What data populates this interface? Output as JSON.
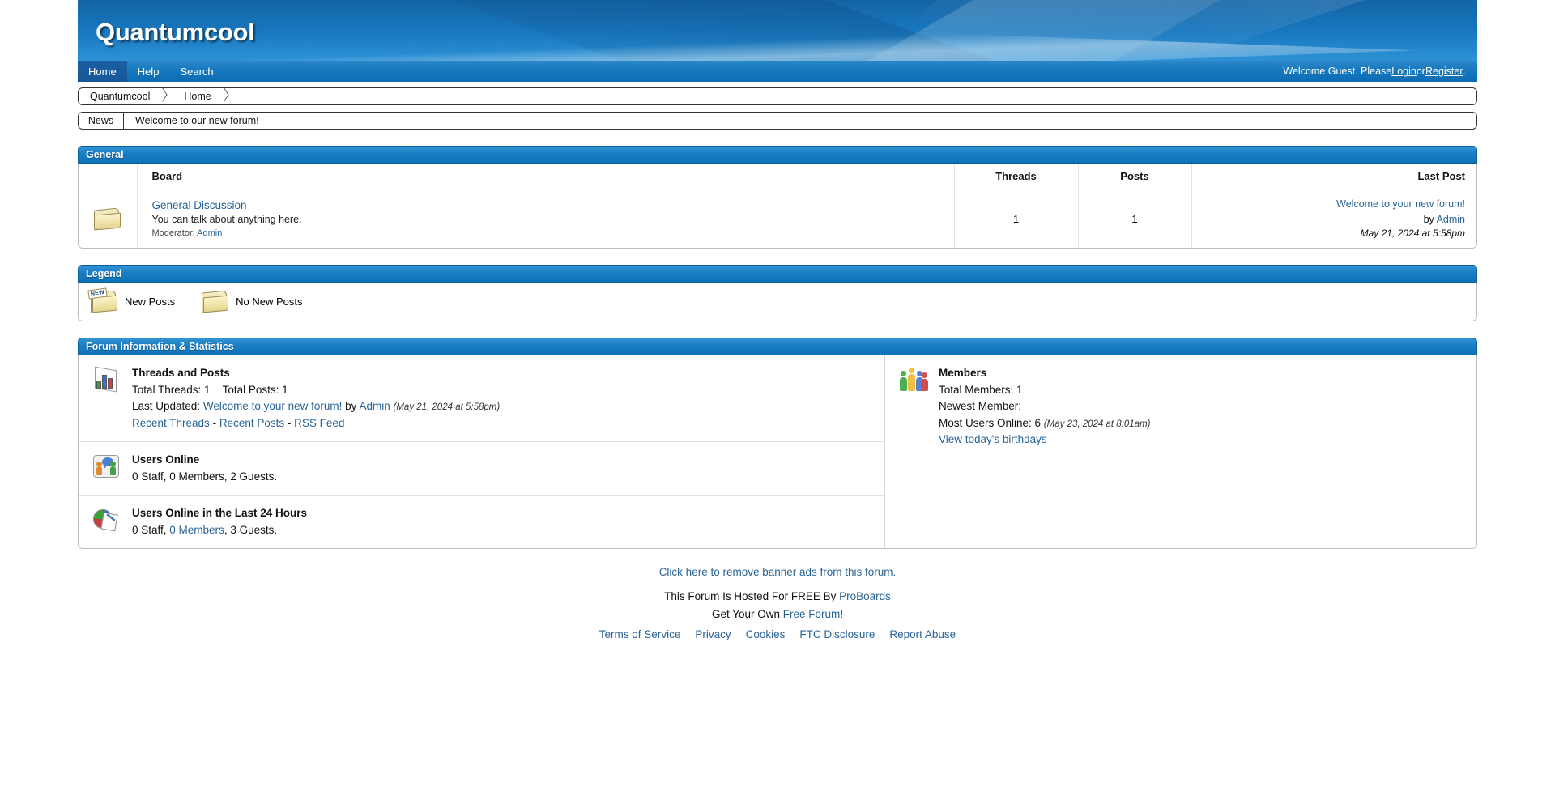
{
  "site": {
    "title": "Quantumcool"
  },
  "nav": {
    "items": [
      {
        "label": "Home",
        "active": true
      },
      {
        "label": "Help",
        "active": false
      },
      {
        "label": "Search",
        "active": false
      }
    ],
    "welcome_prefix": "Welcome Guest. Please ",
    "login_label": "Login",
    "welcome_or": " or ",
    "register_label": "Register",
    "welcome_suffix": "."
  },
  "breadcrumb": {
    "items": [
      "Quantumcool",
      "Home"
    ]
  },
  "news": {
    "label": "News",
    "text": "Welcome to our new forum!"
  },
  "general_section": {
    "heading": "General",
    "columns": {
      "board": "Board",
      "threads": "Threads",
      "posts": "Posts",
      "last_post": "Last Post"
    },
    "rows": [
      {
        "icon": "folder-no-new-posts-icon",
        "title": "General Discussion",
        "description": "You can talk about anything here.",
        "moderator_label": "Moderator:",
        "moderator": "Admin",
        "threads": "1",
        "posts": "1",
        "last_post_title": "Welcome to your new forum!",
        "last_post_by_label": "by",
        "last_post_author": "Admin",
        "last_post_date": "May 21, 2024 at 5:58pm"
      }
    ]
  },
  "legend_section": {
    "heading": "Legend",
    "items": [
      {
        "icon": "folder-new-posts-icon",
        "label": "New Posts"
      },
      {
        "icon": "folder-no-new-posts-icon",
        "label": "No New Posts"
      }
    ]
  },
  "stats_section": {
    "heading": "Forum Information & Statistics",
    "threads_and_posts": {
      "icon": "bar-chart-icon",
      "title": "Threads and Posts",
      "total_threads": "Total Threads: 1",
      "total_posts": "Total Posts: 1",
      "last_updated_label": "Last Updated:",
      "last_updated_thread": "Welcome to your new forum!",
      "last_updated_by": "by",
      "last_updated_author": "Admin",
      "last_updated_date": "(May 21, 2024 at 5:58pm)",
      "links": [
        "Recent Threads",
        "Recent Posts",
        "RSS Feed"
      ],
      "link_sep": "-"
    },
    "members": {
      "icon": "people-group-icon",
      "title": "Members",
      "total_members": "Total Members: 1",
      "newest_member": "Newest Member:",
      "most_users_online": "Most Users Online: 6",
      "most_users_online_date": "(May 23, 2024 at 8:01am)",
      "birthdays_link": "View today's birthdays"
    },
    "users_online": {
      "icon": "users-online-icon",
      "title": "Users Online",
      "text_a": "0 Staff, 0 Members, 2 Guests."
    },
    "users_online_24h": {
      "icon": "pie-chart-icon",
      "title": "Users Online in the Last 24 Hours",
      "prefix": "0 Staff, ",
      "members_link": "0 Members",
      "suffix": ", 3 Guests."
    }
  },
  "footer": {
    "remove_ads": "Click here to remove banner ads from this forum.",
    "hosted_prefix": "This Forum Is Hosted For FREE By ",
    "hosted_link": "ProBoards",
    "get_own_prefix": "Get Your Own ",
    "get_own_link": "Free Forum",
    "get_own_suffix": "!",
    "legal": [
      "Terms of Service",
      "Privacy",
      "Cookies",
      "FTC Disclosure",
      "Report Abuse"
    ]
  },
  "colors": {
    "header_blue": "#1877be",
    "section_head_blue": "#1b7ec4",
    "link_blue": "#2a6496",
    "nav_active": "#1b5fa0"
  }
}
